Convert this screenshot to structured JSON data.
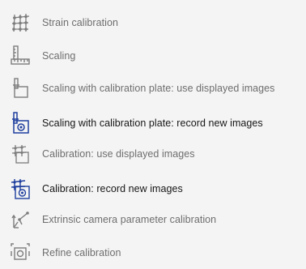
{
  "menu": {
    "items": [
      {
        "label": "Strain calibration",
        "icon": "strain-grid-icon",
        "enabled": false
      },
      {
        "label": "Scaling",
        "icon": "ruler-scaling-icon",
        "enabled": false
      },
      {
        "label": "Scaling with calibration plate: use displayed images",
        "icon": "scaling-plate-displayed-icon",
        "enabled": false
      },
      {
        "label": "Scaling with calibration plate: record new images",
        "icon": "scaling-plate-record-icon",
        "enabled": true
      },
      {
        "label": "Calibration: use displayed images",
        "icon": "calibration-displayed-icon",
        "enabled": false
      },
      {
        "label": "Calibration: record new images",
        "icon": "calibration-record-icon",
        "enabled": true
      },
      {
        "label": "Extrinsic camera parameter calibration",
        "icon": "extrinsic-axes-icon",
        "enabled": false
      },
      {
        "label": "Refine calibration",
        "icon": "refine-calibration-icon",
        "enabled": false
      }
    ]
  },
  "colors": {
    "background": "#f4f4f4",
    "disabled_text": "#6e6e6e",
    "enabled_text": "#161616",
    "icon_gray": "#7d7d7d",
    "icon_blue": "#1f3f9e"
  }
}
